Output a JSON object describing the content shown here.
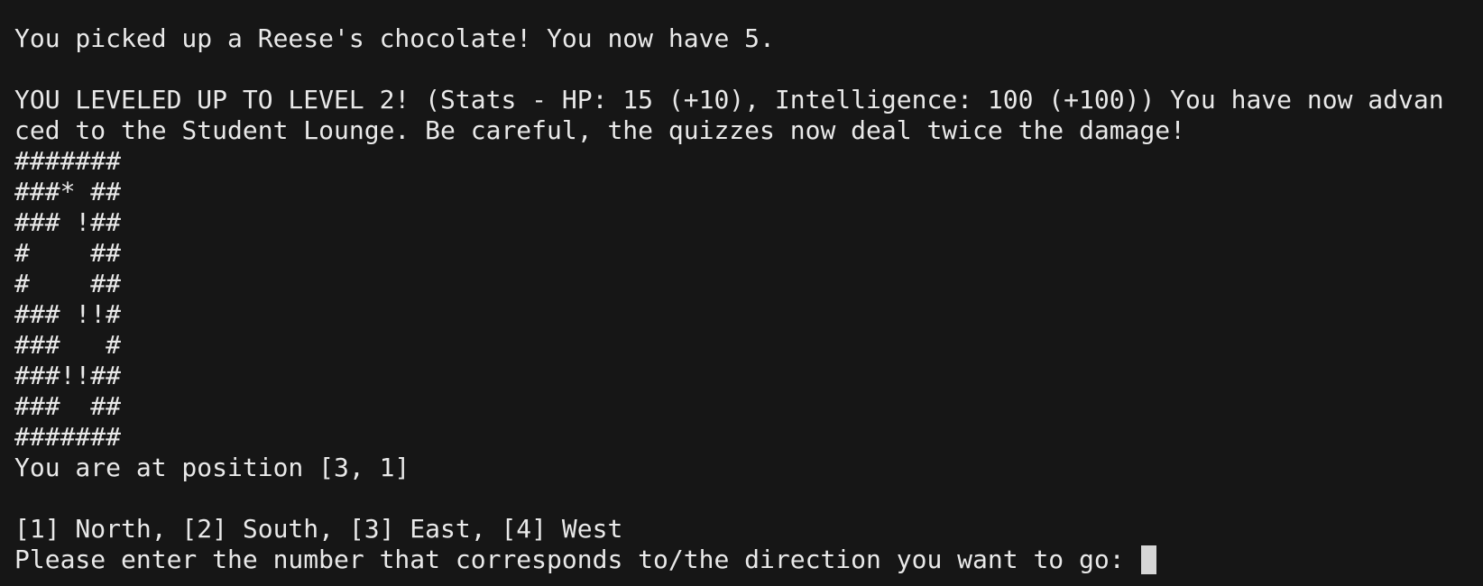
{
  "terminal": {
    "pickup_msg": "You picked up a Reese's chocolate! You now have 5.",
    "levelup_line1": "YOU LEVELED UP TO LEVEL 2! (Stats - HP: 15 (+10), Intelligence: 100 (+100)) You have now advan",
    "levelup_line2": "ced to the Student Lounge. Be careful, the quizzes now deal twice the damage!",
    "map_rows": [
      "#######",
      "###* ##",
      "### !##",
      "#    ##",
      "#    ##",
      "### !!#",
      "###   #",
      "###!!##",
      "###  ##",
      "#######"
    ],
    "position_msg": "You are at position [3, 1]",
    "direction_options": "[1] North, [2] South, [3] East, [4] West",
    "input_prompt": "Please enter the number that corresponds to/the direction you want to go: "
  },
  "colors": {
    "background": "#161616",
    "text": "#e9e9e9",
    "cursor": "#d6d6d6"
  }
}
